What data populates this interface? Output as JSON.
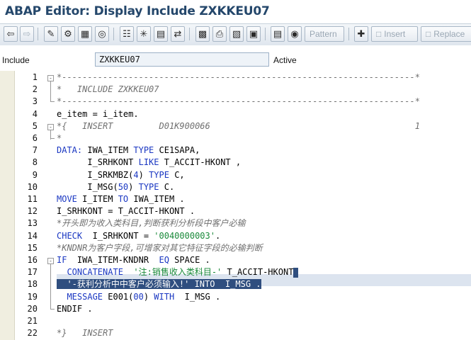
{
  "window": {
    "title": "ABAP Editor: Display Include ZXKKEU07"
  },
  "toolbar": {
    "icons": [
      "back-arrow-icon",
      "forward-arrow-icon",
      "display-change-icon",
      "activate-icon",
      "check-icon",
      "test-icon",
      "where-used-icon",
      "display-object-list-icon",
      "navigation-window-icon",
      "hierarchy-icon",
      "breakpoint-icon",
      "print-icon",
      "enhancement-icon",
      "help-icon",
      "pattern-icon",
      "insert-icon",
      "replace-icon"
    ],
    "pattern_label": "Pattern",
    "insert_label": "Insert",
    "replace_label": "Replace"
  },
  "header": {
    "include_label": "Include",
    "include_value": "ZXKKEU07",
    "status": "Active"
  },
  "editor": {
    "line_numbers": [
      "1",
      "2",
      "3",
      "4",
      "5",
      "6",
      "7",
      "8",
      "9",
      "10",
      "11",
      "12",
      "13",
      "14",
      "15",
      "16",
      "17",
      "18",
      "19",
      "20",
      "21",
      "22"
    ],
    "lines": [
      {
        "type": "comment",
        "text": "*---------------------------------------------------------------------*"
      },
      {
        "type": "comment",
        "text": "*   INCLUDE ZXKKEU07"
      },
      {
        "type": "comment",
        "text": "*---------------------------------------------------------------------*"
      },
      {
        "type": "plain",
        "text": "e_item = i_item."
      },
      {
        "type": "comment",
        "text": "*{   INSERT         D01K900066                                        1"
      },
      {
        "type": "comment",
        "text": "*"
      },
      {
        "type": "data",
        "kw1": "DATA:",
        "rest": " IWA_ITEM ",
        "kw2": "TYPE",
        "rest2": " CE1SAPA,"
      },
      {
        "type": "data",
        "kw1": "      ",
        "rest": "I_SRHKONT ",
        "kw2": "LIKE",
        "rest2": " T_ACCIT-HKONT ,"
      },
      {
        "type": "data3",
        "text1": "      I_SRKMBZ(",
        "num": "4",
        "text2": ") ",
        "kw": "TYPE",
        "text3": " C,"
      },
      {
        "type": "data3",
        "text1": "      I_MSG(",
        "num": "50",
        "text2": ") ",
        "kw": "TYPE",
        "text3": " C."
      },
      {
        "type": "move",
        "kw1": "MOVE",
        "rest": " I_ITEM ",
        "kw2": "TO",
        "rest2": " IWA_ITEM ."
      },
      {
        "type": "plain",
        "text": "I_SRHKONT = T_ACCIT-HKONT ."
      },
      {
        "type": "comment",
        "text": "*开头即为收入类科目,判断获利分析段中客户必输"
      },
      {
        "type": "check",
        "kw": "CHECK",
        "rest": "  I_SRHKONT = ",
        "str": "'0040000003'",
        "end": "."
      },
      {
        "type": "comment",
        "text": "*KNDNR为客户字段,可增家对其它特征字段的必输判断"
      },
      {
        "type": "if",
        "kw": "IF",
        "rest": "  IWA_ITEM-KNDNR  ",
        "kw2": "EQ",
        "kw3": " SPACE",
        "end": " ."
      },
      {
        "type": "concat",
        "kw": "  CONCATENATE",
        "str": "  '注:销售收入类科目-'",
        "rest": " T_ACCIT-HKONT"
      },
      {
        "type": "selected",
        "text": "  '-获利分析中中客户必须输入!' INTO  I_MSG ."
      },
      {
        "type": "message",
        "kw": "  MESSAGE",
        "rest": " E001(",
        "num": "00",
        "rest2": ") ",
        "kw2": "WITH",
        "rest3": "  I_MSG ."
      },
      {
        "type": "endif",
        "kw": "ENDIF",
        "end": " ."
      },
      {
        "type": "plain",
        "text": ""
      },
      {
        "type": "comment",
        "text": "*}   INSERT"
      }
    ]
  }
}
